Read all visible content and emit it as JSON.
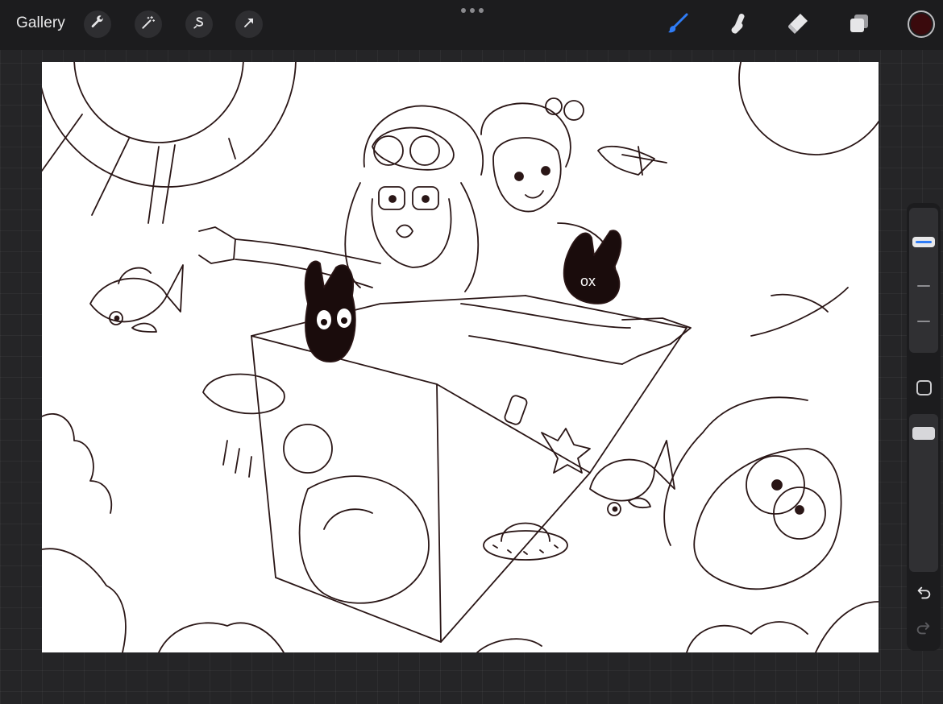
{
  "toolbar": {
    "gallery_label": "Gallery",
    "left_tools": [
      {
        "name": "actions",
        "icon": "wrench-icon"
      },
      {
        "name": "adjustments",
        "icon": "magic-wand-icon"
      },
      {
        "name": "selection",
        "icon": "selection-s-icon"
      },
      {
        "name": "transform",
        "icon": "arrow-cursor-icon"
      }
    ],
    "more_menu_icon": "ellipsis-icon",
    "right_tools": [
      {
        "name": "brush",
        "icon": "brush-icon",
        "active": true
      },
      {
        "name": "smudge",
        "icon": "smudge-finger-icon",
        "active": false
      },
      {
        "name": "eraser",
        "icon": "eraser-icon",
        "active": false
      },
      {
        "name": "layers",
        "icon": "layers-icon",
        "active": false
      }
    ],
    "current_color": "#3a0a0d"
  },
  "colors": {
    "active_tool": "#2f7cf6",
    "ui_icon": "#e6e6e8",
    "line_art": "#2a1616"
  },
  "sidebar": {
    "brush_size_slider": {
      "level": 0.2
    },
    "opacity_slider": {
      "level": 0.0
    },
    "modifier_icon": "square-modifier-icon",
    "undo_icon": "undo-icon",
    "redo_icon": "redo-icon"
  }
}
